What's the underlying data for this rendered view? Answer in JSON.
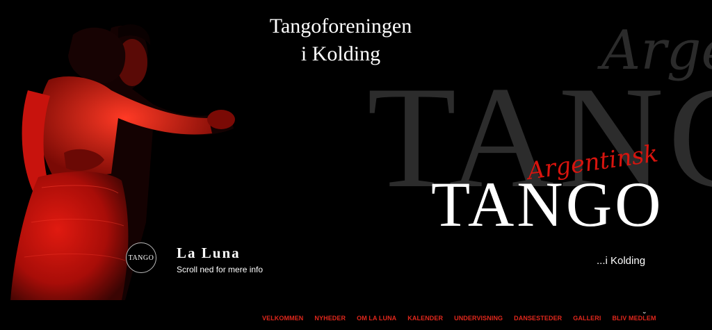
{
  "header": {
    "title_line1": "Tangoforeningen",
    "title_line2": "i Kolding"
  },
  "hero": {
    "bg_word_script": "Argen",
    "bg_word_main": "TANGO",
    "logo_script": "Argentinsk",
    "logo_main": "TANGO",
    "logo_place": "...i Kolding"
  },
  "brand": {
    "logo_text": "TANGO",
    "name": "La Luna",
    "tagline": "Scroll ned for mere info"
  },
  "nav": {
    "items": [
      {
        "label": "VELKOMMEN"
      },
      {
        "label": "NYHEDER"
      },
      {
        "label": "OM LA LUNA"
      },
      {
        "label": "KALENDER"
      },
      {
        "label": "UNDERVISNING"
      },
      {
        "label": "DANSESTEDER"
      },
      {
        "label": "GALLERI"
      },
      {
        "label": "BLIV MEDLEM"
      }
    ],
    "more_icon": "chevron-down-icon",
    "more_glyph": "˘"
  },
  "colors": {
    "background": "#000000",
    "accent_red": "#e1271c",
    "dress_red": "#c8130d",
    "bg_word_gray": "#2c2c2c"
  }
}
